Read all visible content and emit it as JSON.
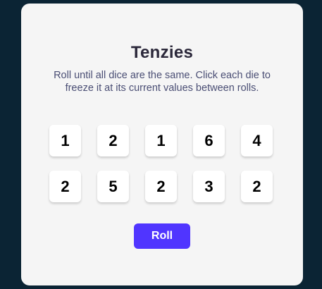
{
  "game": {
    "title": "Tenzies",
    "instructions": "Roll until all dice are the same. Click each die to freeze it at its current values between rolls.",
    "dice": [
      {
        "value": "1"
      },
      {
        "value": "2"
      },
      {
        "value": "1"
      },
      {
        "value": "6"
      },
      {
        "value": "4"
      },
      {
        "value": "2"
      },
      {
        "value": "5"
      },
      {
        "value": "2"
      },
      {
        "value": "3"
      },
      {
        "value": "2"
      }
    ],
    "roll_label": "Roll"
  },
  "colors": {
    "page_background": "#0b2434",
    "board_background": "#f5f5f5",
    "die_background": "#ffffff",
    "button_accent": "#5035ff",
    "title_text": "#2b283a",
    "instructions_text": "#4a4e74"
  }
}
